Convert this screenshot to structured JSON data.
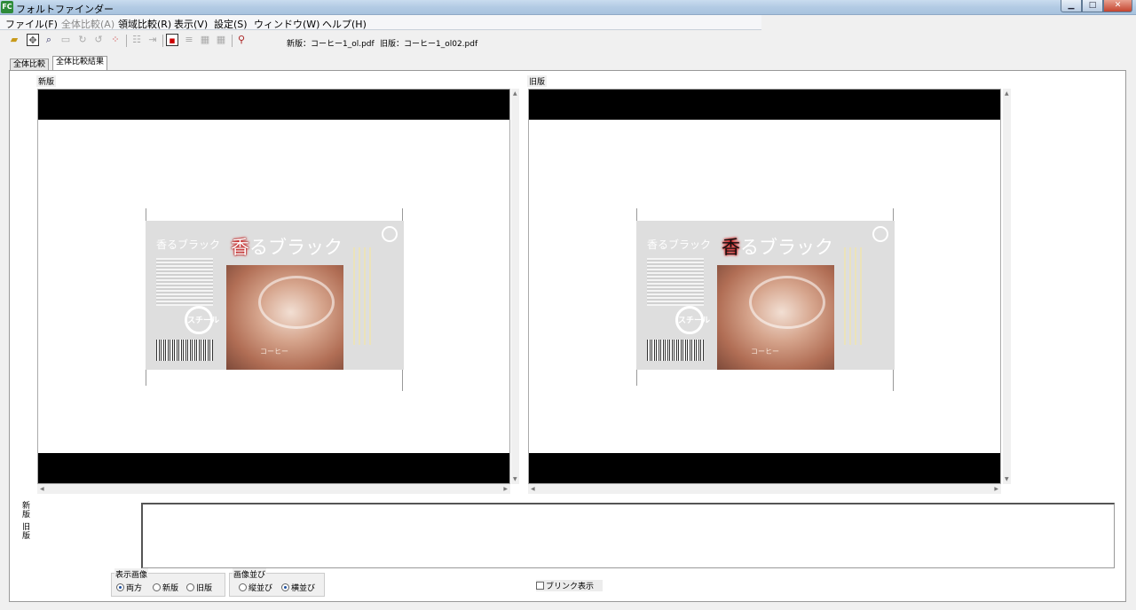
{
  "window": {
    "title": "フォルトファインダー",
    "icon_text": "FC"
  },
  "menu": {
    "file": "ファイル(F)",
    "full_compare": "全体比較(A)",
    "region_compare": "領域比較(R)",
    "view": "表示(V)",
    "settings": "設定(S)",
    "window": "ウィンドウ(W)",
    "help": "ヘルプ(H)"
  },
  "toolbar": {
    "new_file_info": "新版：コーヒー1_ol.pdf",
    "old_file_info": "旧版：コーヒー1_ol02.pdf",
    "icons": [
      "open-folder-icon",
      "move-icon",
      "zoom-icon",
      "select-rect-icon",
      "rotate-cw-icon",
      "rotate-ccw-icon",
      "diff-points-icon",
      "compare-icon",
      "ocr-icon"
    ]
  },
  "tabs": {
    "full_compare": "全体比較",
    "full_compare_result": "全体比較結果"
  },
  "panes": {
    "new_label": "新版",
    "old_label": "旧版"
  },
  "artwork": {
    "side_title": "香るブラック",
    "title_first_char": "香",
    "title_rest": "るブラック",
    "logo_text": "スチール",
    "cup_label": "コーヒー"
  },
  "bottom": {
    "new_vertical": "新版",
    "old_vertical": "旧版",
    "display_image_title": "表示画像",
    "radio_both": "両方",
    "radio_new": "新版",
    "radio_old": "旧版",
    "arrange_title": "画像並び",
    "radio_vertical": "縦並び",
    "radio_horizontal": "横並び",
    "blink_label": "ブリンク表示"
  },
  "state": {
    "display_image_selected": "両方",
    "arrange_selected": "横並び",
    "blink_checked": false
  },
  "colors": {
    "diff_highlight": "#cc0000",
    "title_bar": "#b3cbe4"
  }
}
